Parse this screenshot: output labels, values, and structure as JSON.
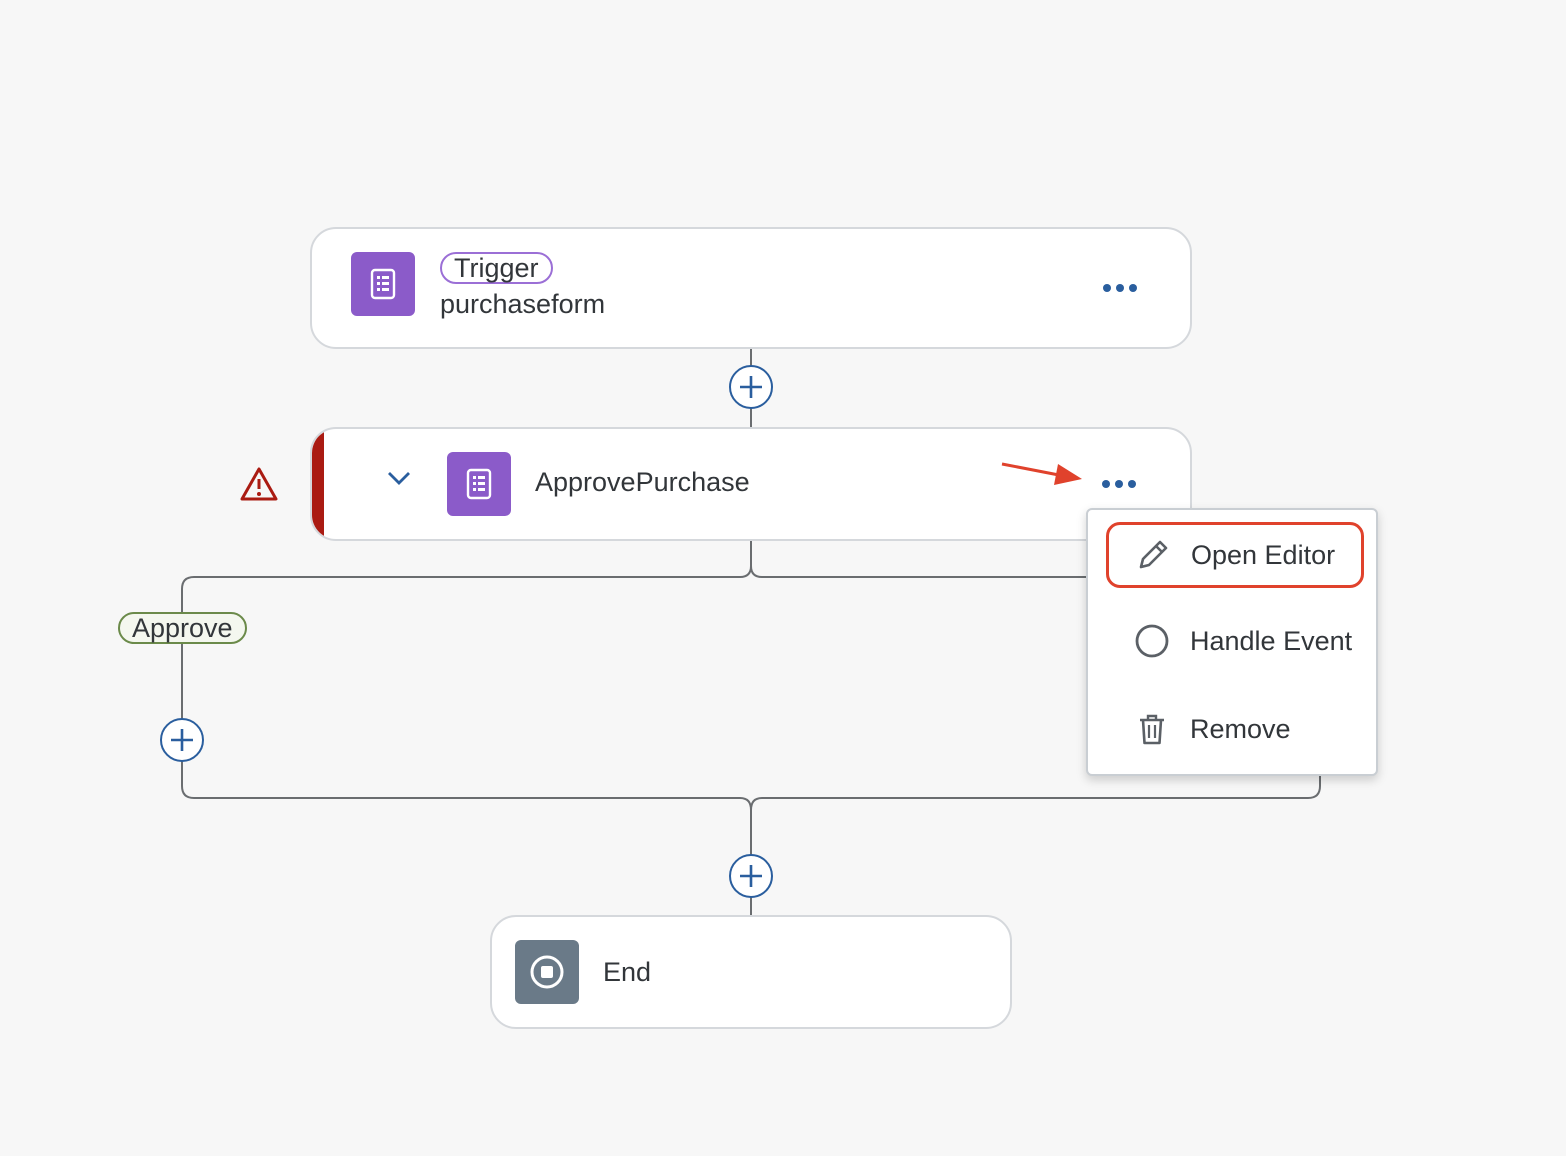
{
  "trigger_node": {
    "tag": "Trigger",
    "title": "purchaseform",
    "icon": "form-icon",
    "accent": "#8b5bc9"
  },
  "approval_node": {
    "title": "ApprovePurchase",
    "icon": "form-icon",
    "status": "error",
    "status_color": "#aa1b12",
    "accent": "#8b5bc9"
  },
  "branch": {
    "label": "Approve"
  },
  "end_node": {
    "title": "End",
    "icon": "stop-icon",
    "accent": "#6a7a88"
  },
  "context_menu": {
    "items": [
      {
        "label": "Open Editor",
        "icon": "pencil-icon",
        "highlighted": true
      },
      {
        "label": "Handle Event",
        "icon": "circle-icon"
      },
      {
        "label": "Remove",
        "icon": "trash-icon"
      }
    ],
    "highlight_color": "#e0422c"
  },
  "colors": {
    "link": "#2a5e9e",
    "connector": "#6a6d70",
    "annotation": "#e0422c"
  }
}
